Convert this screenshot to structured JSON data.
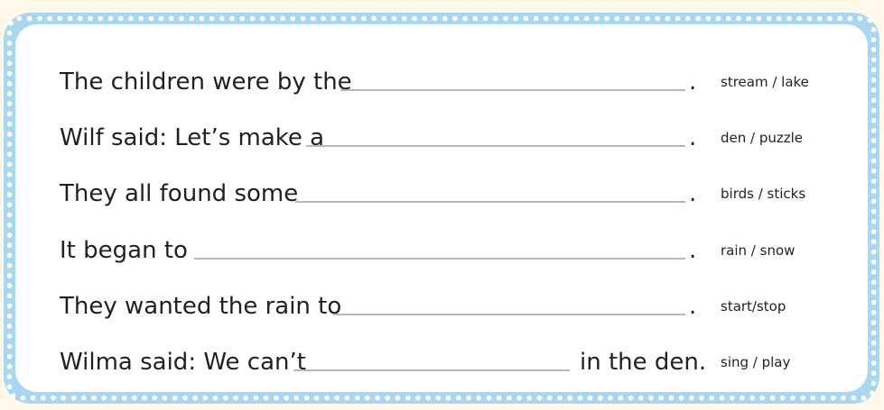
{
  "worksheet": {
    "rows": [
      {
        "sentence": "The children were by the",
        "ending": ".",
        "choices": "stream / lake"
      },
      {
        "sentence": "Wilf said: Let’s make a",
        "ending": ".",
        "choices": "den / puzzle"
      },
      {
        "sentence": "They all found some",
        "ending": ".",
        "choices": "birds / sticks"
      },
      {
        "sentence": "It began to",
        "ending": ".",
        "choices": "rain / snow"
      },
      {
        "sentence": "They wanted the rain to",
        "ending": ".",
        "choices": "start/stop"
      },
      {
        "sentence": "Wilma said: We can’t",
        "ending": "in the den.",
        "choices": "sing / play"
      }
    ]
  },
  "colors": {
    "border": "#a9d7f1",
    "dots": "#ffffff",
    "card": "#ffffff",
    "text": "#231f20",
    "blank_line": "#b8b8b8"
  }
}
